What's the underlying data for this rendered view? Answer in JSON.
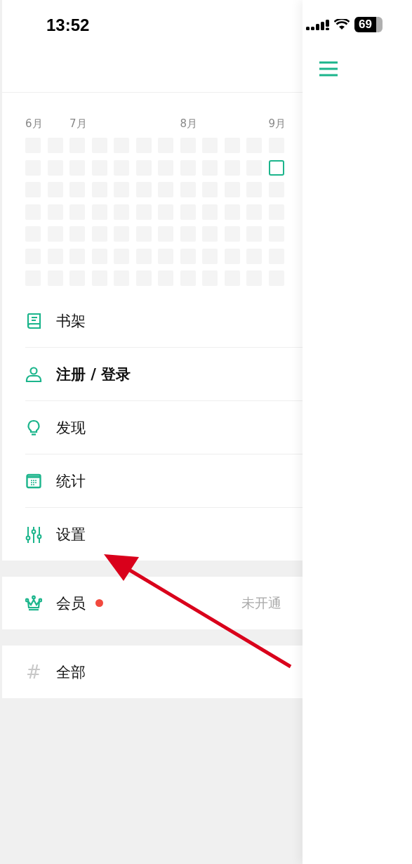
{
  "status_bar": {
    "time": "13:52",
    "battery": "69"
  },
  "heatmap": {
    "weeks": [
      {
        "month": "6月",
        "days": [
          {
            "today": false
          },
          {
            "today": false
          },
          {
            "today": false
          },
          {
            "today": false
          },
          {
            "today": false
          },
          {
            "today": false
          },
          {
            "today": false
          }
        ]
      },
      {
        "days": [
          {
            "today": false
          },
          {
            "today": false
          },
          {
            "today": false
          },
          {
            "today": false
          },
          {
            "today": false
          },
          {
            "today": false
          },
          {
            "today": false
          }
        ]
      },
      {
        "month": "7月",
        "days": [
          {
            "today": false
          },
          {
            "today": false
          },
          {
            "today": false
          },
          {
            "today": false
          },
          {
            "today": false
          },
          {
            "today": false
          },
          {
            "today": false
          }
        ]
      },
      {
        "days": [
          {
            "today": false
          },
          {
            "today": false
          },
          {
            "today": false
          },
          {
            "today": false
          },
          {
            "today": false
          },
          {
            "today": false
          },
          {
            "today": false
          }
        ]
      },
      {
        "days": [
          {
            "today": false
          },
          {
            "today": false
          },
          {
            "today": false
          },
          {
            "today": false
          },
          {
            "today": false
          },
          {
            "today": false
          },
          {
            "today": false
          }
        ]
      },
      {
        "days": [
          {
            "today": false
          },
          {
            "today": false
          },
          {
            "today": false
          },
          {
            "today": false
          },
          {
            "today": false
          },
          {
            "today": false
          },
          {
            "today": false
          }
        ]
      },
      {
        "days": [
          {
            "today": false
          },
          {
            "today": false
          },
          {
            "today": false
          },
          {
            "today": false
          },
          {
            "today": false
          },
          {
            "today": false
          },
          {
            "today": false
          }
        ]
      },
      {
        "month": "8月",
        "days": [
          {
            "today": false
          },
          {
            "today": false
          },
          {
            "today": false
          },
          {
            "today": false
          },
          {
            "today": false
          },
          {
            "today": false
          },
          {
            "today": false
          }
        ]
      },
      {
        "days": [
          {
            "today": false
          },
          {
            "today": false
          },
          {
            "today": false
          },
          {
            "today": false
          },
          {
            "today": false
          },
          {
            "today": false
          },
          {
            "today": false
          }
        ]
      },
      {
        "days": [
          {
            "today": false
          },
          {
            "today": false
          },
          {
            "today": false
          },
          {
            "today": false
          },
          {
            "today": false
          },
          {
            "today": false
          },
          {
            "today": false
          }
        ]
      },
      {
        "days": [
          {
            "today": false
          },
          {
            "today": false
          },
          {
            "today": false
          },
          {
            "today": false
          },
          {
            "today": false
          },
          {
            "today": false
          },
          {
            "today": false
          }
        ]
      },
      {
        "month": "9月",
        "days": [
          {
            "today": false
          },
          {
            "today": true
          },
          {
            "today": false
          },
          {
            "today": false
          },
          {
            "today": false
          },
          {
            "today": false
          },
          {
            "today": false
          }
        ]
      }
    ]
  },
  "menu_groups": [
    {
      "items": [
        {
          "kind": "book",
          "label": "书架",
          "emphasized": false
        },
        {
          "kind": "person",
          "label": "注册 / 登录",
          "emphasized": true
        },
        {
          "kind": "bulb",
          "label": "发现",
          "emphasized": false
        },
        {
          "kind": "calendar",
          "label": "统计",
          "emphasized": false
        },
        {
          "kind": "sliders",
          "label": "设置",
          "emphasized": false
        }
      ]
    },
    {
      "items": [
        {
          "kind": "crown",
          "label": "会员",
          "emphasized": false,
          "badge": true,
          "value": "未开通"
        }
      ]
    },
    {
      "items": [
        {
          "kind": "hash",
          "label": "#",
          "emphasized": false,
          "label_2": "全部"
        }
      ]
    }
  ]
}
